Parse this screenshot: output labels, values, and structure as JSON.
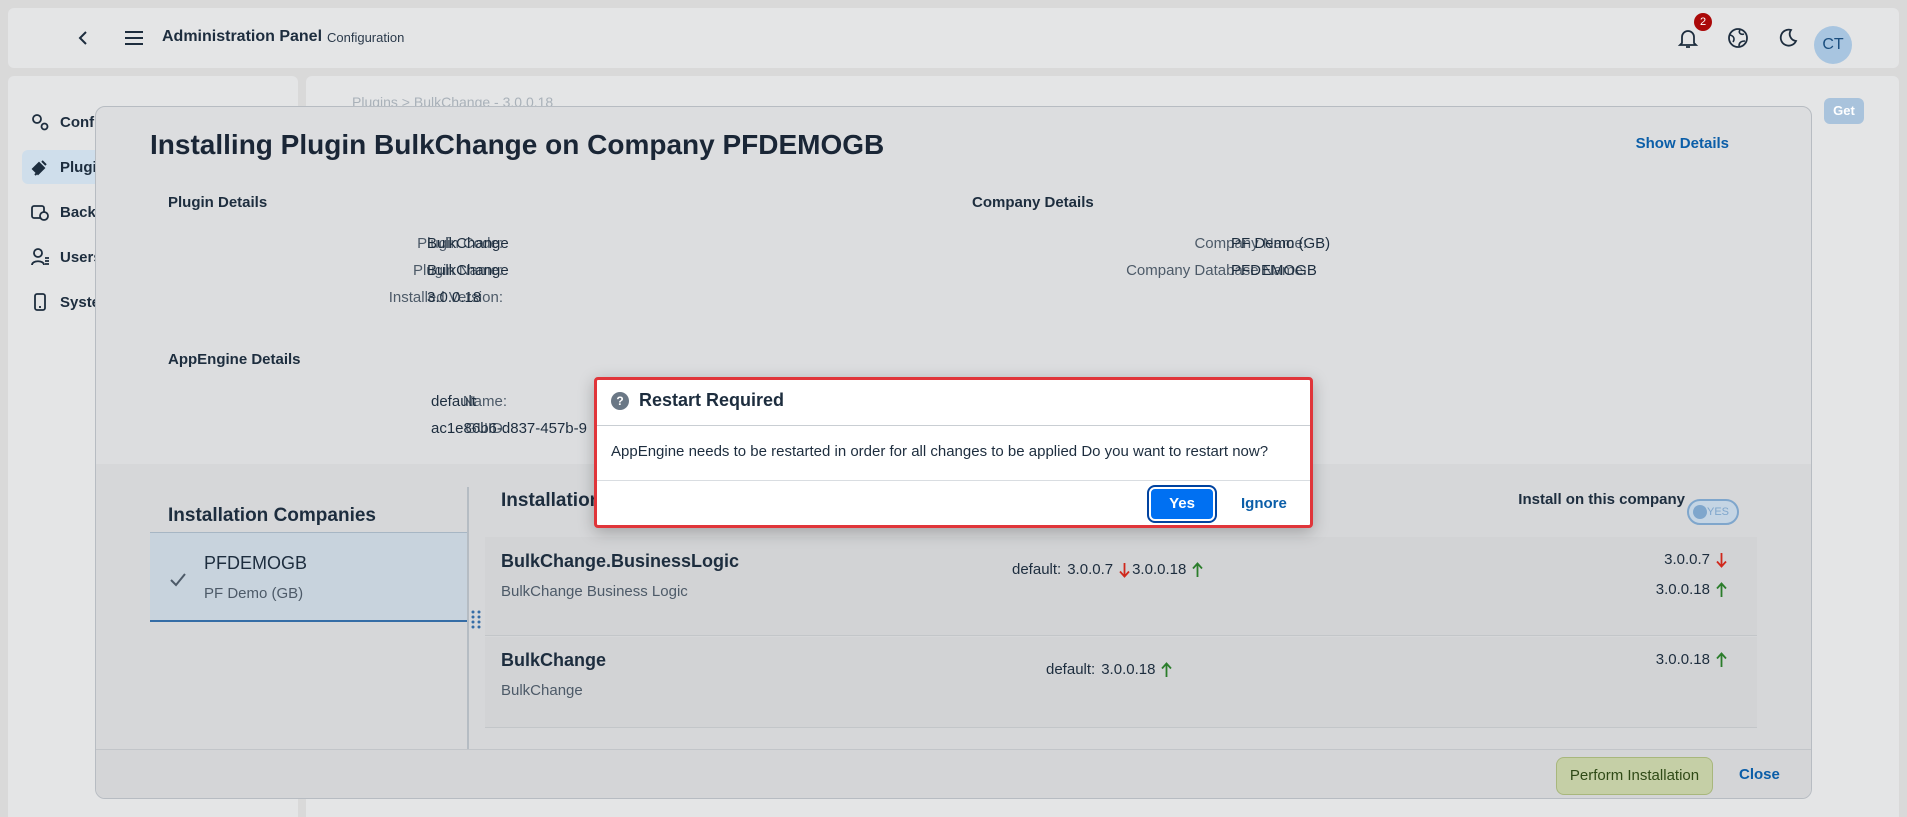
{
  "shell": {
    "title": "Administration Panel",
    "subtitle": "Configuration",
    "notification_count": "2",
    "avatar_initials": "CT"
  },
  "nav": {
    "items": [
      {
        "label": "Conf",
        "icon": "gear-icon"
      },
      {
        "label": "Plugi",
        "icon": "plugin-icon"
      },
      {
        "label": "Back",
        "icon": "backup-icon"
      },
      {
        "label": "Users",
        "icon": "users-icon"
      },
      {
        "label": "Syste",
        "icon": "device-icon"
      }
    ]
  },
  "page": {
    "breadcrumb": "Plugins > BulkChange - 3.0.0.18",
    "get_label": "Get"
  },
  "dialog": {
    "title": "Installing Plugin BulkChange on Company PFDEMOGB",
    "show_details": "Show Details",
    "plugin_details": {
      "heading": "Plugin Details",
      "code_label": "Plugin Code:",
      "code": "BulkChange",
      "name_label": "Plugin Name:",
      "name": "BulkChange",
      "version_label": "Installed Version:",
      "version": "3.0.0.18"
    },
    "company_details": {
      "heading": "Company Details",
      "name_label": "Company Name:",
      "name": "PF Demo (GB)",
      "db_label": "Company Database Name:",
      "db": "PFDEMOGB"
    },
    "appengine_details": {
      "heading": "AppEngine Details",
      "name_label": "Name:",
      "name": "default",
      "guid_label": "GUID:",
      "guid": "ac1e86b6-d837-457b-9"
    },
    "installation_companies": {
      "heading": "Installation Companies",
      "company": {
        "code": "PFDEMOGB",
        "name": "PF Demo (GB)"
      }
    },
    "installation_table": {
      "heading": "Installation",
      "install_on_company": "Install on this company",
      "toggle_label": "YES",
      "rows": [
        {
          "name": "BulkChange.BusinessLogic",
          "description": "BulkChange Business Logic",
          "env_label": "default:",
          "from_version": "3.0.0.7",
          "to_version": "3.0.0.18",
          "right_old": "3.0.0.7",
          "right_new": "3.0.0.18"
        },
        {
          "name": "BulkChange",
          "description": "BulkChange",
          "env_label": "default:",
          "to_version": "3.0.0.18",
          "right_new": "3.0.0.18"
        }
      ]
    },
    "footer": {
      "perform_label": "Perform Installation",
      "close_label": "Close"
    }
  },
  "popup": {
    "title": "Restart Required",
    "message": "AppEngine needs to be restarted in order for all changes to be applied Do you want to restart now?",
    "yes_label": "Yes",
    "ignore_label": "Ignore"
  },
  "colors": {
    "accent": "#0070f2",
    "link": "#0b5ea8",
    "arrow_down": "#d0281c",
    "arrow_up": "#2b7d2b",
    "popup_border": "#e0353a"
  }
}
